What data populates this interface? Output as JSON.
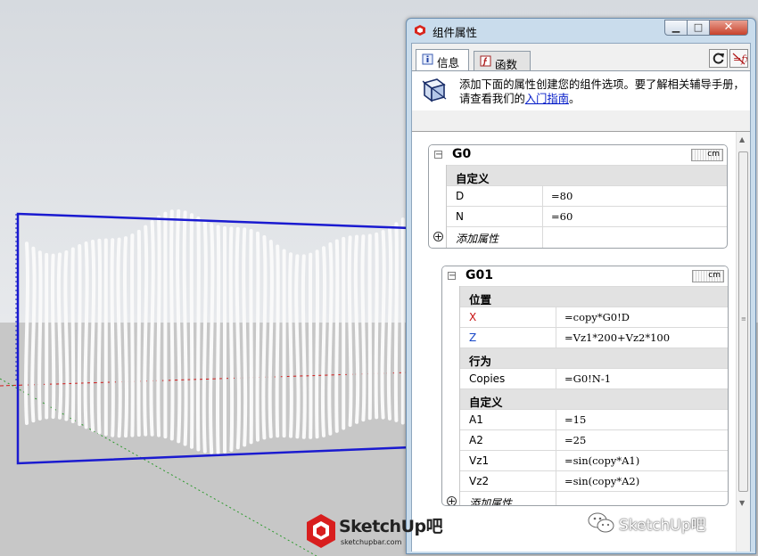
{
  "dialog": {
    "title": "组件属性",
    "tabs": [
      {
        "label": "信息"
      },
      {
        "label": "函数"
      }
    ],
    "info_text_before_link": "添加下面的属性创建您的组件选项。要了解相关辅导手册，请查看我们的",
    "info_link": "入门指南",
    "info_text_after_link": "。",
    "components": [
      {
        "name": "G0",
        "unit": "cm",
        "groups": [
          {
            "label": "自定义",
            "rows": [
              {
                "key": "D",
                "value": "=80"
              },
              {
                "key": "N",
                "value": "=60"
              }
            ]
          }
        ],
        "add_label": "添加属性"
      },
      {
        "name": "G01",
        "unit": "cm",
        "groups": [
          {
            "label": "位置",
            "rows": [
              {
                "key": "X",
                "value": "=copy*G0!D"
              },
              {
                "key": "Z",
                "value": "=Vz1*200+Vz2*100"
              }
            ]
          },
          {
            "label": "行为",
            "rows": [
              {
                "key": "Copies",
                "value": "=G0!N-1"
              }
            ]
          },
          {
            "label": "自定义",
            "rows": [
              {
                "key": "A1",
                "value": "=15"
              },
              {
                "key": "A2",
                "value": "=25"
              },
              {
                "key": "Vz1",
                "value": "=sin(copy*A1)"
              },
              {
                "key": "Vz2",
                "value": "=sin(copy*A2)"
              }
            ]
          }
        ],
        "add_label": "添加属性"
      }
    ]
  },
  "watermarks": {
    "logo_text": "SketchUp吧",
    "logo_url": "sketchupbar.com",
    "wechat_text": "SketchUp吧"
  },
  "colors": {
    "selection_box": "#1a1ad0",
    "x_key": "#c81010",
    "z_key": "#1848c8",
    "close_button": "#c8412b",
    "link": "#0018c7"
  },
  "icons": {
    "app": "sketchup-logo-icon",
    "info_tab": "info-icon",
    "functions_tab": "function-icon",
    "refresh": "refresh-icon",
    "formula": "formula-toggle-icon",
    "component": "component-box-icon"
  }
}
